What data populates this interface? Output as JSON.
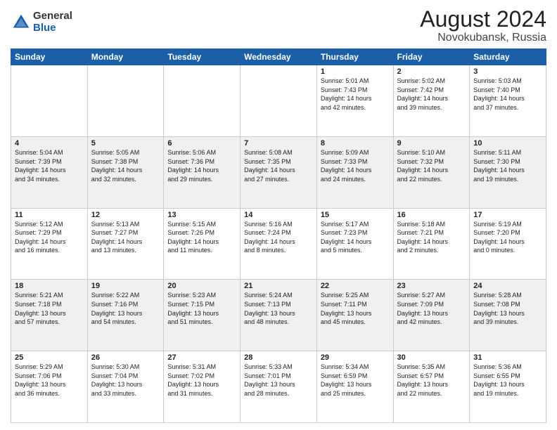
{
  "logo": {
    "general": "General",
    "blue": "Blue"
  },
  "title": "August 2024",
  "subtitle": "Novokubansk, Russia",
  "days_of_week": [
    "Sunday",
    "Monday",
    "Tuesday",
    "Wednesday",
    "Thursday",
    "Friday",
    "Saturday"
  ],
  "weeks": [
    [
      {
        "day": "",
        "info": ""
      },
      {
        "day": "",
        "info": ""
      },
      {
        "day": "",
        "info": ""
      },
      {
        "day": "",
        "info": ""
      },
      {
        "day": "1",
        "info": "Sunrise: 5:01 AM\nSunset: 7:43 PM\nDaylight: 14 hours\nand 42 minutes."
      },
      {
        "day": "2",
        "info": "Sunrise: 5:02 AM\nSunset: 7:42 PM\nDaylight: 14 hours\nand 39 minutes."
      },
      {
        "day": "3",
        "info": "Sunrise: 5:03 AM\nSunset: 7:40 PM\nDaylight: 14 hours\nand 37 minutes."
      }
    ],
    [
      {
        "day": "4",
        "info": "Sunrise: 5:04 AM\nSunset: 7:39 PM\nDaylight: 14 hours\nand 34 minutes."
      },
      {
        "day": "5",
        "info": "Sunrise: 5:05 AM\nSunset: 7:38 PM\nDaylight: 14 hours\nand 32 minutes."
      },
      {
        "day": "6",
        "info": "Sunrise: 5:06 AM\nSunset: 7:36 PM\nDaylight: 14 hours\nand 29 minutes."
      },
      {
        "day": "7",
        "info": "Sunrise: 5:08 AM\nSunset: 7:35 PM\nDaylight: 14 hours\nand 27 minutes."
      },
      {
        "day": "8",
        "info": "Sunrise: 5:09 AM\nSunset: 7:33 PM\nDaylight: 14 hours\nand 24 minutes."
      },
      {
        "day": "9",
        "info": "Sunrise: 5:10 AM\nSunset: 7:32 PM\nDaylight: 14 hours\nand 22 minutes."
      },
      {
        "day": "10",
        "info": "Sunrise: 5:11 AM\nSunset: 7:30 PM\nDaylight: 14 hours\nand 19 minutes."
      }
    ],
    [
      {
        "day": "11",
        "info": "Sunrise: 5:12 AM\nSunset: 7:29 PM\nDaylight: 14 hours\nand 16 minutes."
      },
      {
        "day": "12",
        "info": "Sunrise: 5:13 AM\nSunset: 7:27 PM\nDaylight: 14 hours\nand 13 minutes."
      },
      {
        "day": "13",
        "info": "Sunrise: 5:15 AM\nSunset: 7:26 PM\nDaylight: 14 hours\nand 11 minutes."
      },
      {
        "day": "14",
        "info": "Sunrise: 5:16 AM\nSunset: 7:24 PM\nDaylight: 14 hours\nand 8 minutes."
      },
      {
        "day": "15",
        "info": "Sunrise: 5:17 AM\nSunset: 7:23 PM\nDaylight: 14 hours\nand 5 minutes."
      },
      {
        "day": "16",
        "info": "Sunrise: 5:18 AM\nSunset: 7:21 PM\nDaylight: 14 hours\nand 2 minutes."
      },
      {
        "day": "17",
        "info": "Sunrise: 5:19 AM\nSunset: 7:20 PM\nDaylight: 14 hours\nand 0 minutes."
      }
    ],
    [
      {
        "day": "18",
        "info": "Sunrise: 5:21 AM\nSunset: 7:18 PM\nDaylight: 13 hours\nand 57 minutes."
      },
      {
        "day": "19",
        "info": "Sunrise: 5:22 AM\nSunset: 7:16 PM\nDaylight: 13 hours\nand 54 minutes."
      },
      {
        "day": "20",
        "info": "Sunrise: 5:23 AM\nSunset: 7:15 PM\nDaylight: 13 hours\nand 51 minutes."
      },
      {
        "day": "21",
        "info": "Sunrise: 5:24 AM\nSunset: 7:13 PM\nDaylight: 13 hours\nand 48 minutes."
      },
      {
        "day": "22",
        "info": "Sunrise: 5:25 AM\nSunset: 7:11 PM\nDaylight: 13 hours\nand 45 minutes."
      },
      {
        "day": "23",
        "info": "Sunrise: 5:27 AM\nSunset: 7:09 PM\nDaylight: 13 hours\nand 42 minutes."
      },
      {
        "day": "24",
        "info": "Sunrise: 5:28 AM\nSunset: 7:08 PM\nDaylight: 13 hours\nand 39 minutes."
      }
    ],
    [
      {
        "day": "25",
        "info": "Sunrise: 5:29 AM\nSunset: 7:06 PM\nDaylight: 13 hours\nand 36 minutes."
      },
      {
        "day": "26",
        "info": "Sunrise: 5:30 AM\nSunset: 7:04 PM\nDaylight: 13 hours\nand 33 minutes."
      },
      {
        "day": "27",
        "info": "Sunrise: 5:31 AM\nSunset: 7:02 PM\nDaylight: 13 hours\nand 31 minutes."
      },
      {
        "day": "28",
        "info": "Sunrise: 5:33 AM\nSunset: 7:01 PM\nDaylight: 13 hours\nand 28 minutes."
      },
      {
        "day": "29",
        "info": "Sunrise: 5:34 AM\nSunset: 6:59 PM\nDaylight: 13 hours\nand 25 minutes."
      },
      {
        "day": "30",
        "info": "Sunrise: 5:35 AM\nSunset: 6:57 PM\nDaylight: 13 hours\nand 22 minutes."
      },
      {
        "day": "31",
        "info": "Sunrise: 5:36 AM\nSunset: 6:55 PM\nDaylight: 13 hours\nand 19 minutes."
      }
    ]
  ]
}
